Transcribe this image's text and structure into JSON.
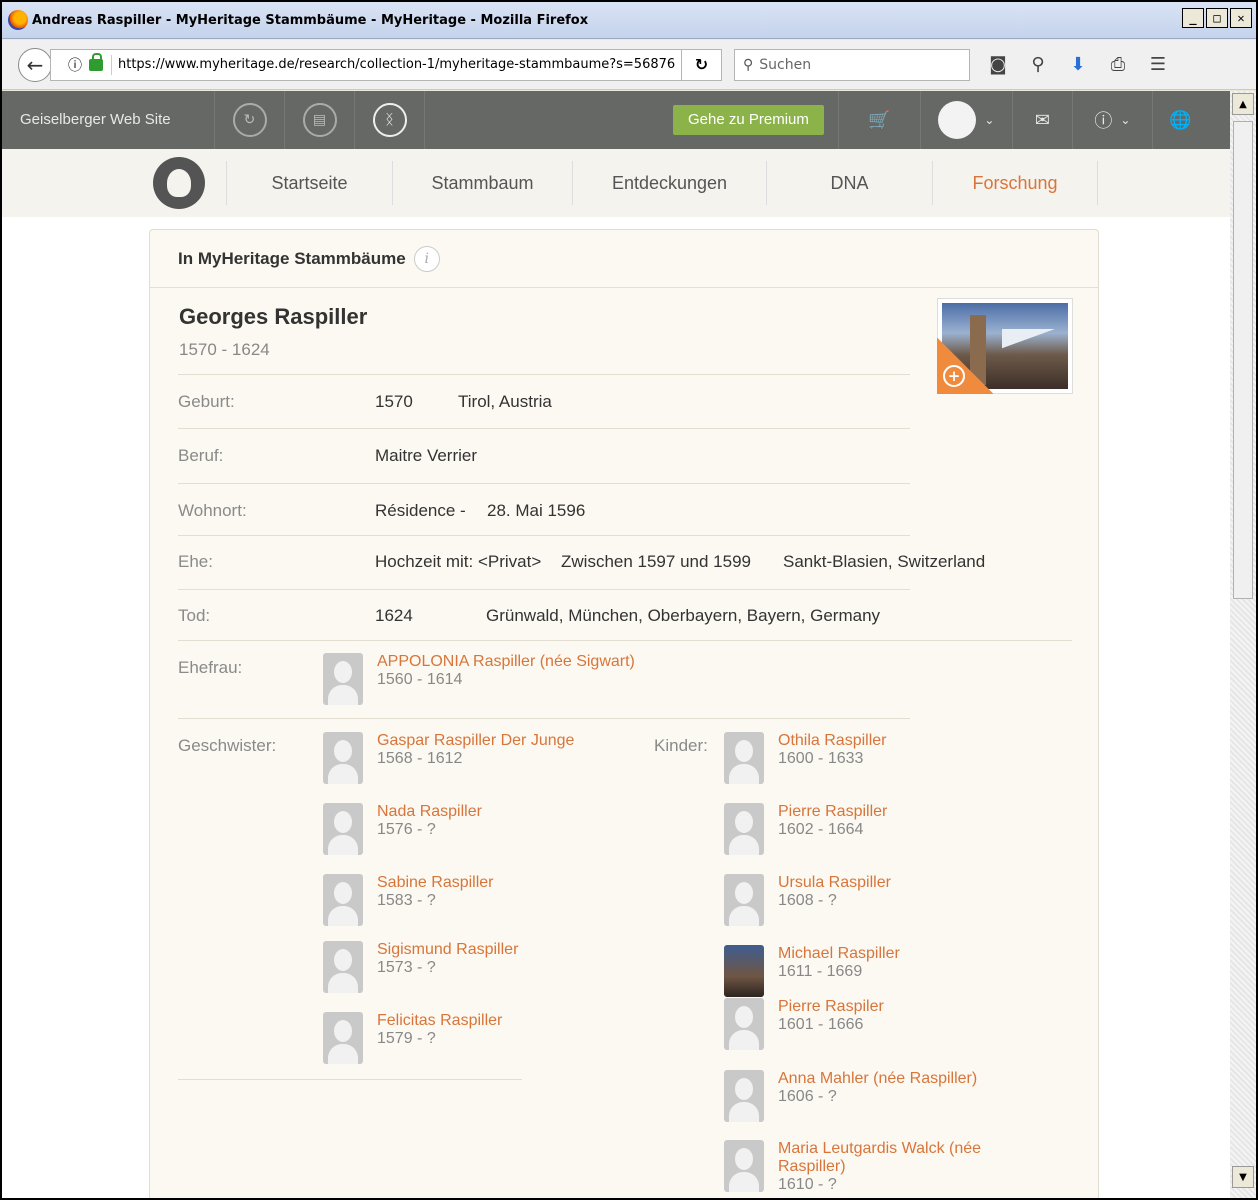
{
  "window": {
    "title": "Andreas Raspiller - MyHeritage Stammbäume - MyHeritage - Mozilla Firefox"
  },
  "browser": {
    "url": "https://www.myheritage.de/research/collection-1/myheritage-stammbaume?s=56876",
    "search_placeholder": "Suchen"
  },
  "topbar": {
    "site_name": "Geiselberger Web Site",
    "premium_label": "Gehe zu Premium"
  },
  "nav": {
    "items": [
      {
        "label": "Startseite"
      },
      {
        "label": "Stammbaum"
      },
      {
        "label": "Entdeckungen"
      },
      {
        "label": "DNA"
      },
      {
        "label": "Forschung"
      }
    ]
  },
  "record": {
    "collection": "In MyHeritage Stammbäume",
    "name": "Georges Raspiller",
    "dates": "1570 - 1624",
    "facts": {
      "birth": {
        "label": "Geburt:",
        "date": "1570",
        "place": "Tirol, Austria"
      },
      "occupation": {
        "label": "Beruf:",
        "value": "Maitre Verrier"
      },
      "residence": {
        "label": "Wohnort:",
        "value": "Résidence -",
        "date": "28. Mai 1596"
      },
      "marriage": {
        "label": "Ehe:",
        "value": "Hochzeit mit: <Privat>",
        "date": "Zwischen 1597 und 1599",
        "place": "Sankt-Blasien, Switzerland"
      },
      "death": {
        "label": "Tod:",
        "date": "1624",
        "place": "Grünwald, München, Oberbayern, Bayern, Germany"
      }
    },
    "spouse_label": "Ehefrau:",
    "spouse": {
      "name": "APPOLONIA Raspiller (née  Sigwart)",
      "dates": "1560 - 1614"
    },
    "siblings_label": "Geschwister:",
    "siblings": [
      {
        "name": "Gaspar Raspiller  Der Junge",
        "dates": "1568 - 1612"
      },
      {
        "name": "Nada Raspiller",
        "dates": "1576 - ?"
      },
      {
        "name": "Sabine Raspiller",
        "dates": "1583 - ?"
      },
      {
        "name": "Sigismund Raspiller",
        "dates": "1573 - ?"
      },
      {
        "name": "Felicitas Raspiller",
        "dates": "1579 - ?"
      }
    ],
    "children_label": "Kinder:",
    "children": [
      {
        "name": "Othila Raspiller",
        "dates": "1600 - 1633"
      },
      {
        "name": "Pierre Raspiller",
        "dates": "1602 - 1664"
      },
      {
        "name": "Ursula Raspiller",
        "dates": "1608 - ?"
      },
      {
        "name": "Michael Raspiller",
        "dates": "1611 - 1669"
      },
      {
        "name": "Pierre Raspiler",
        "dates": "1601 - 1666"
      },
      {
        "name": "Anna Mahler (née Raspiller)",
        "dates": "1606 - ?"
      },
      {
        "name": "Maria Leutgardis Walck (née Raspiller)",
        "dates": "1610 - ?"
      }
    ]
  }
}
